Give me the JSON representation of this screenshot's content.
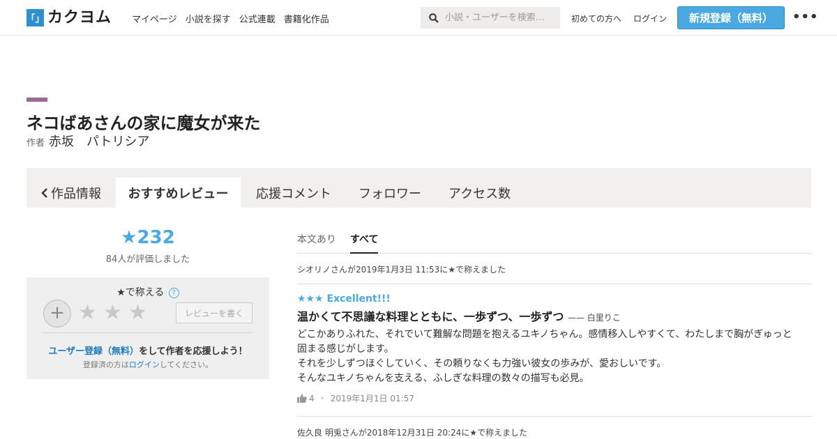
{
  "header": {
    "logo_mark": "「」",
    "logo_text": "カクヨム",
    "nav": [
      "マイページ",
      "小説を探す",
      "公式連載",
      "書籍化作品"
    ],
    "search_placeholder": "小説・ユーザーを検索…",
    "first_time": "初めての方へ",
    "login": "ログイン",
    "signup": "新規登録（無料）",
    "more": "•••"
  },
  "work": {
    "title": "ネコばあさんの家に魔女が来た",
    "author_label": "作者",
    "author_name": "赤坂　パトリシア"
  },
  "tabs": {
    "back": "作品情報",
    "active": "おすすめレビュー",
    "items": [
      "応援コメント",
      "フォロワー",
      "アクセス数"
    ]
  },
  "rating": {
    "score": "★232",
    "raters": "84人が評価しました",
    "praise_title": "★で称える",
    "help": "?",
    "plus": "+",
    "stars": [
      "★",
      "★",
      "★"
    ],
    "write_review": "レビューを書く",
    "cta_link": "ユーザー登録（無料）",
    "cta_rest": "をして作者を応援しよう！",
    "note_pre": "登録済の方は",
    "note_link": "ログイン",
    "note_post": "してください。"
  },
  "filter": {
    "with_text": "本文あり",
    "all": "すべて"
  },
  "reviews": [
    {
      "meta": "シオリノさんが2019年1月3日 11:53に★で称えました",
      "stars": "★★★ Excellent!!!",
      "headline": "温かくて不思議な料理とともに、一歩ずつ、一歩ずつ",
      "by": "—— 白里りこ",
      "body": [
        "どこかありふれた、それでいて難解な問題を抱えるユキノちゃん。感情移入しやすくて、わたしまで胸がぎゅっと固まる感じがします。",
        "それを少しずつほぐしていく、その頼りなくも力強い彼女の歩みが、愛おしいです。",
        "そんなユキノちゃんを支える、ふしぎな料理の数々の描写も必見。"
      ],
      "likes": "4",
      "date": "2019年1月1日 01:57"
    },
    {
      "meta": "佐久良 明兎さんが2018年12月31日 20:24に★で称えました"
    }
  ],
  "colors": {
    "accent": "#4aa9e0",
    "link": "#1e7bbf",
    "title_bar": "#9b6b97"
  }
}
